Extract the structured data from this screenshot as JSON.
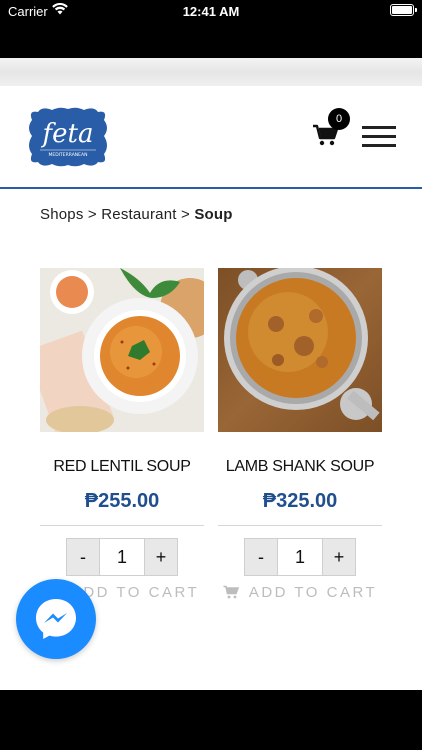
{
  "status_bar": {
    "carrier": "Carrier",
    "time": "12:41 AM"
  },
  "header": {
    "logo_text": "feta",
    "logo_subtext": "MEDITERRANEAN",
    "cart_count": "0",
    "brand_color": "#2a5da8"
  },
  "breadcrumb": {
    "item1": "Shops",
    "sep1": " > ",
    "item2": "Restaurant",
    "sep2": " > ",
    "current": "Soup"
  },
  "products": [
    {
      "name": "RED LENTIL SOUP",
      "price": "₱255.00",
      "qty": "1",
      "minus": "-",
      "plus": "+",
      "add_to_cart": "ADD TO CART"
    },
    {
      "name": "LAMB SHANK SOUP",
      "price": "₱325.00",
      "qty": "1",
      "minus": "-",
      "plus": "+",
      "add_to_cart": "ADD TO CART"
    }
  ],
  "colors": {
    "price": "#1f4f8f",
    "messenger": "#1a8cff"
  }
}
